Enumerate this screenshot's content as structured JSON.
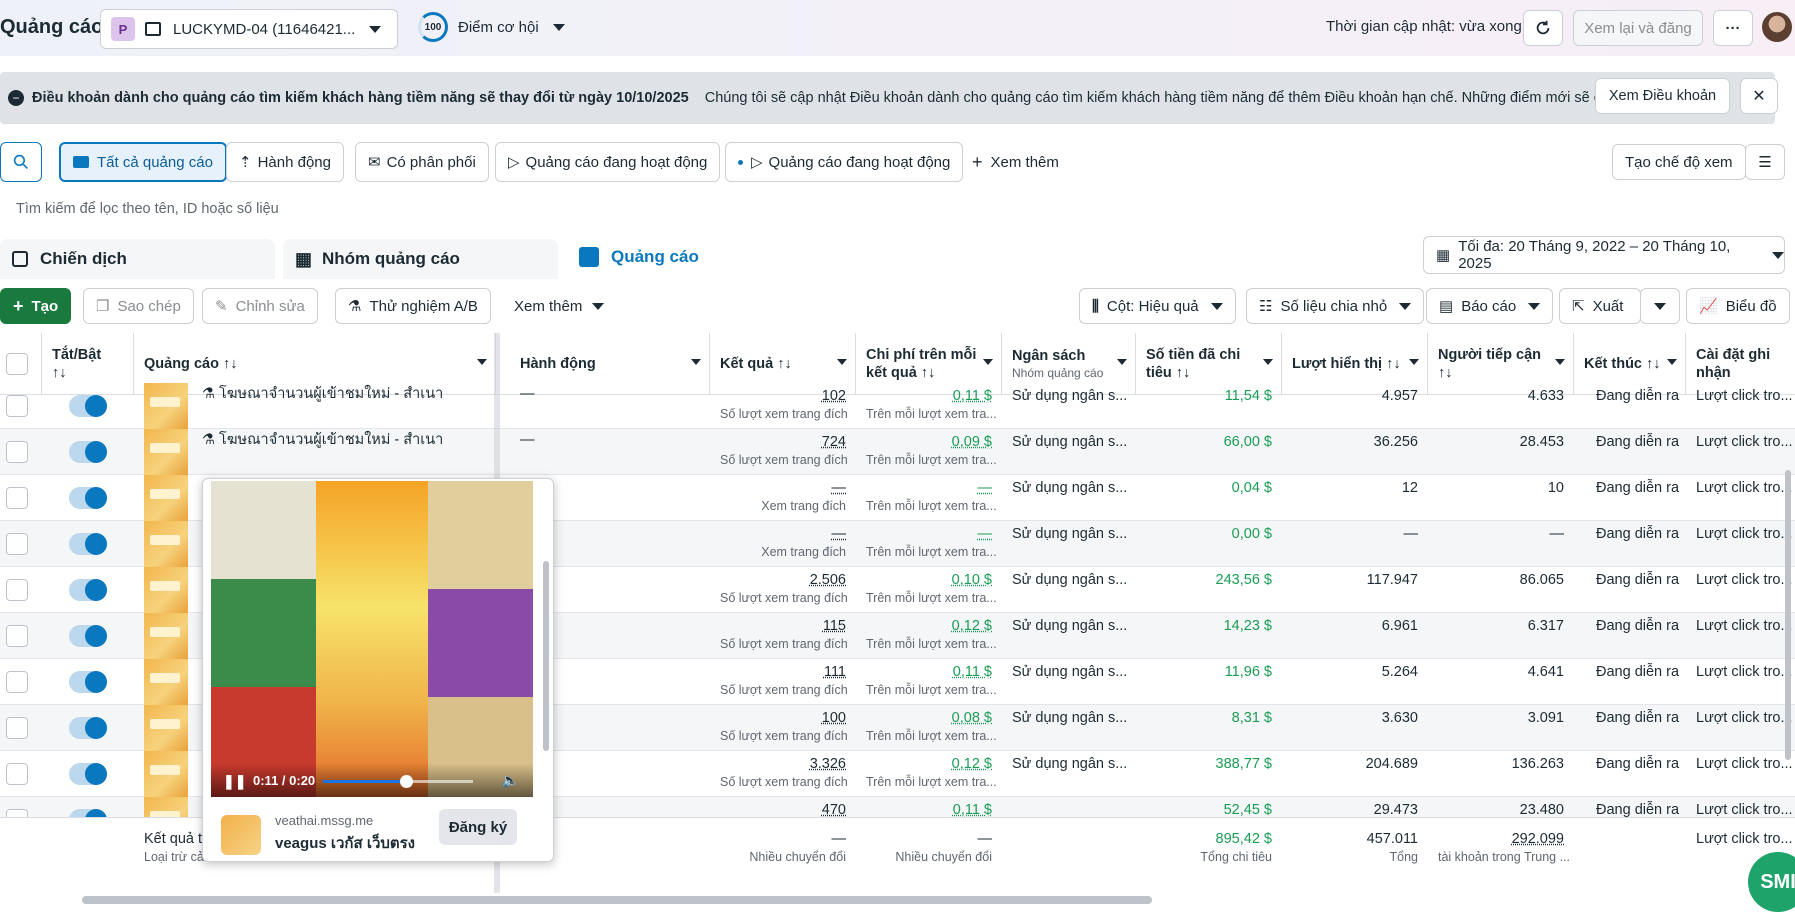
{
  "header": {
    "title": "Quảng cáo",
    "account_badge": "P",
    "account_name": "LUCKYMD-04 (11646421...",
    "score_value": "100",
    "score_label": "Điểm cơ hội",
    "updated": "Thời gian cập nhật: vừa xong",
    "review_button": "Xem lại và đăng",
    "more_button": "···"
  },
  "notice": {
    "title": "Điều khoản dành cho quảng cáo tìm kiếm khách hàng tiềm năng sẽ thay đổi từ ngày 10/10/2025",
    "body": "Chúng tôi sẽ cập nhật Điều khoản dành cho quảng cáo tìm kiếm khách hàng tiềm năng để thêm Điều khoản hạn chế. Những điểm mới sẽ có hiệ...",
    "button": "Xem Điều khoản",
    "close": "✕"
  },
  "filters": {
    "chips": [
      "Tất cả quảng cáo",
      "Hành động",
      "Có phân phối",
      "Quảng cáo đang hoạt động",
      "Quảng cáo đang hoạt động"
    ],
    "more": "Xem thêm",
    "create_view": "Tạo chế độ xem",
    "search_placeholder": "Tìm kiếm để lọc theo tên, ID hoặc số liệu"
  },
  "tabs": {
    "campaigns": "Chiến dịch",
    "adsets": "Nhóm quảng cáo",
    "ads": "Quảng cáo",
    "date_range": "Tối đa: 20 Tháng 9, 2022 – 20 Tháng 10, 2025"
  },
  "toolbar": {
    "create": "Tạo",
    "copy": "Sao chép",
    "edit": "Chỉnh sửa",
    "ab_test": "Thử nghiệm A/B",
    "more": "Xem thêm",
    "columns": "Cột: Hiệu quả",
    "breakdown": "Số liệu chia nhỏ",
    "reports": "Báo cáo",
    "export": "Xuất",
    "chart": "Biểu đồ"
  },
  "columns": {
    "toggle": "Tắt/Bật",
    "toggle_sort": "↑↓",
    "ad": "Quảng cáo ↑↓",
    "actions": "Hành động",
    "results": "Kết quả ↑↓",
    "cost_per_result": "Chi phí trên mỗi kết quả ↑↓",
    "budget": "Ngân sách",
    "budget_sub": "Nhóm quảng cáo",
    "spent": "Số tiền đã chi tiêu ↑↓",
    "impressions": "Lượt hiển thị ↑↓",
    "reach": "Người tiếp cận ↑↓",
    "ends": "Kết thúc ↑↓",
    "attribution": "Cài đặt ghi nhận"
  },
  "rows": [
    {
      "name": "โฆษณาจำนวนผู้เข้าชมใหม่ - สำเนา",
      "action": "—",
      "result": "102",
      "result_sub": "Số lượt xem trang đích",
      "cpr": "0,11 $",
      "cpr_sub": "Trên mỗi lượt xem tra...",
      "budget": "Sử dụng ngân s...",
      "spent": "11,54 $",
      "impr": "4.957",
      "reach": "4.633",
      "ends": "Đang diễn ra",
      "attr": "Lượt click tro..."
    },
    {
      "name": "โฆษณาจำนวนผู้เข้าชมใหม่ - สำเนา",
      "action": "—",
      "result": "724",
      "result_sub": "Số lượt xem trang đích",
      "cpr": "0,09 $",
      "cpr_sub": "Trên mỗi lượt xem tra...",
      "budget": "Sử dụng ngân s...",
      "spent": "66,00 $",
      "impr": "36.256",
      "reach": "28.453",
      "ends": "Đang diễn ra",
      "attr": "Lượt click tro..."
    },
    {
      "name": "",
      "action": "",
      "result": "—",
      "result_sub": "Xem trang đích",
      "cpr": "—",
      "cpr_sub": "Trên mỗi lượt xem tra...",
      "budget": "Sử dụng ngân s...",
      "spent": "0,04 $",
      "impr": "12",
      "reach": "10",
      "ends": "Đang diễn ra",
      "attr": "Lượt click tro..."
    },
    {
      "name": "",
      "action": "",
      "result": "—",
      "result_sub": "Xem trang đích",
      "cpr": "—",
      "cpr_sub": "Trên mỗi lượt xem tra...",
      "budget": "Sử dụng ngân s...",
      "spent": "0,00 $",
      "impr": "—",
      "reach": "—",
      "ends": "Đang diễn ra",
      "attr": "Lượt click tro..."
    },
    {
      "name": "",
      "action": "",
      "result": "2.506",
      "result_sub": "Số lượt xem trang đích",
      "cpr": "0,10 $",
      "cpr_sub": "Trên mỗi lượt xem tra...",
      "budget": "Sử dụng ngân s...",
      "spent": "243,56 $",
      "impr": "117.947",
      "reach": "86.065",
      "ends": "Đang diễn ra",
      "attr": "Lượt click tro..."
    },
    {
      "name": "",
      "action": "",
      "result": "115",
      "result_sub": "Số lượt xem trang đích",
      "cpr": "0,12 $",
      "cpr_sub": "Trên mỗi lượt xem tra...",
      "budget": "Sử dụng ngân s...",
      "spent": "14,23 $",
      "impr": "6.961",
      "reach": "6.317",
      "ends": "Đang diễn ra",
      "attr": "Lượt click tro..."
    },
    {
      "name": "",
      "action": "",
      "result": "111",
      "result_sub": "Số lượt xem trang đích",
      "cpr": "0,11 $",
      "cpr_sub": "Trên mỗi lượt xem tra...",
      "budget": "Sử dụng ngân s...",
      "spent": "11,96 $",
      "impr": "5.264",
      "reach": "4.641",
      "ends": "Đang diễn ra",
      "attr": "Lượt click tro..."
    },
    {
      "name": "",
      "action": "",
      "result": "100",
      "result_sub": "Số lượt xem trang đích",
      "cpr": "0,08 $",
      "cpr_sub": "Trên mỗi lượt xem tra...",
      "budget": "Sử dụng ngân s...",
      "spent": "8,31 $",
      "impr": "3.630",
      "reach": "3.091",
      "ends": "Đang diễn ra",
      "attr": "Lượt click tro..."
    },
    {
      "name": "",
      "action": "",
      "result": "3.326",
      "result_sub": "Số lượt xem trang đích",
      "cpr": "0,12 $",
      "cpr_sub": "Trên mỗi lượt xem tra...",
      "budget": "Sử dụng ngân s...",
      "spent": "388,77 $",
      "impr": "204.689",
      "reach": "136.263",
      "ends": "Đang diễn ra",
      "attr": "Lượt click tro..."
    },
    {
      "name": "",
      "action": "",
      "result": "470",
      "result_sub": "",
      "cpr": "0,11 $",
      "cpr_sub": "",
      "budget": "",
      "spent": "52,45 $",
      "impr": "29.473",
      "reach": "23.480",
      "ends": "Đang diễn ra",
      "attr": "Lượt click tro..."
    }
  ],
  "footer": {
    "label": "Kết quả t",
    "label_sub": "Loại trừ cả",
    "result": "—",
    "result_sub": "Nhiều chuyển đổi",
    "cpr": "—",
    "cpr_sub": "Nhiều chuyển đổi",
    "spent": "895,42 $",
    "spent_sub": "Tổng chi tiêu",
    "impr": "457.011",
    "impr_sub": "Tổng",
    "reach": "292.099",
    "reach_sub": "tài khoản trong Trung ...",
    "attr": "Lượt click tro..."
  },
  "preview": {
    "time": "0:11 / 0:20",
    "progress": 0.55,
    "domain": "veathai.mssg.me",
    "page_name": "veagus เวกัส เว็บตรง",
    "cta": "Đăng ký"
  },
  "fab": "SMI"
}
